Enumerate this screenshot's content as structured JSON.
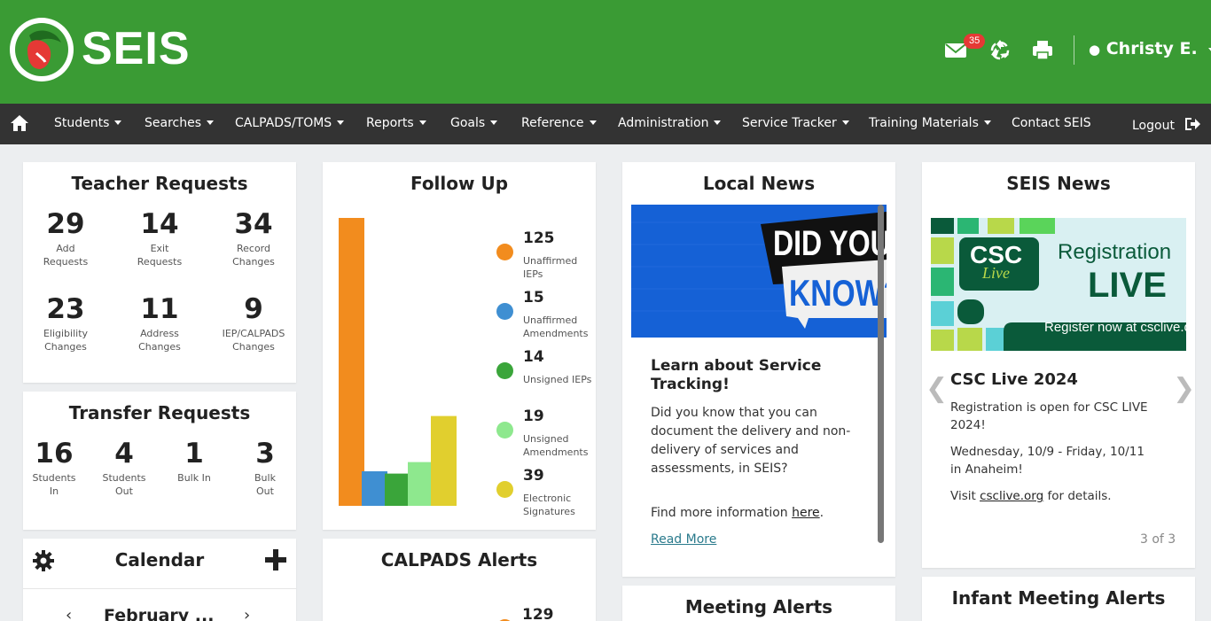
{
  "header": {
    "logo_text": "SEIS",
    "mail_badge": "35",
    "user_name": "Christy E."
  },
  "nav": {
    "items": [
      "Students",
      "Searches",
      "CALPADS/TOMS",
      "Reports",
      "Goals",
      "Reference",
      "Administration",
      "Service Tracker",
      "Training Materials",
      "Contact SEIS"
    ],
    "logout": "Logout"
  },
  "teacher_requests": {
    "title": "Teacher Requests",
    "stats": [
      {
        "num": "29",
        "l1": "Add",
        "l2": "Requests"
      },
      {
        "num": "14",
        "l1": "Exit",
        "l2": "Requests"
      },
      {
        "num": "34",
        "l1": "Record",
        "l2": "Changes"
      },
      {
        "num": "23",
        "l1": "Eligibility",
        "l2": "Changes"
      },
      {
        "num": "11",
        "l1": "Address",
        "l2": "Changes"
      },
      {
        "num": "9",
        "l1": "IEP/CALPADS",
        "l2": "Changes"
      }
    ]
  },
  "transfer_requests": {
    "title": "Transfer Requests",
    "stats": [
      {
        "num": "16",
        "l1": "Students",
        "l2": "In"
      },
      {
        "num": "4",
        "l1": "Students",
        "l2": "Out"
      },
      {
        "num": "1",
        "l1": "Bulk In",
        "l2": ""
      },
      {
        "num": "3",
        "l1": "Bulk",
        "l2": "Out"
      }
    ]
  },
  "calendar": {
    "title": "Calendar",
    "month": "February ..."
  },
  "follow_up": {
    "title": "Follow Up"
  },
  "chart_data": {
    "type": "bar",
    "categories": [
      "Unaffirmed IEPs",
      "Unaffirmed Amendments",
      "Unsigned IEPs",
      "Unsigned Amendments",
      "Electronic Signatures"
    ],
    "values": [
      125,
      15,
      14,
      19,
      39
    ],
    "colors": [
      "#f28c1e",
      "#3f8fd2",
      "#3aa53a",
      "#8ee88e",
      "#e1cf2e"
    ],
    "legend": [
      {
        "num": "125",
        "l1": "Unaffirmed",
        "l2": "IEPs"
      },
      {
        "num": "15",
        "l1": "Unaffirmed",
        "l2": "Amendments"
      },
      {
        "num": "14",
        "l1": "Unsigned IEPs",
        "l2": ""
      },
      {
        "num": "19",
        "l1": "Unsigned",
        "l2": "Amendments"
      },
      {
        "num": "39",
        "l1": "Electronic",
        "l2": "Signatures"
      }
    ]
  },
  "calpads_alerts": {
    "title": "CALPADS Alerts",
    "first_value": "129"
  },
  "local_news": {
    "title": "Local News",
    "image_text_1": "DID YOU",
    "image_text_2": "KNOW?",
    "heading": "Learn about Service Tracking!",
    "body": "Did you know that you can document the delivery and non-delivery of services and assessments, in SEIS?",
    "more_prefix": "Find more information ",
    "more_link": "here",
    "more_suffix": ".",
    "read_more": "Read More"
  },
  "meeting_alerts": {
    "title": "Meeting Alerts"
  },
  "seis_news": {
    "title": "SEIS News",
    "image_logo_1": "CSC",
    "image_logo_2": "Live",
    "image_text_1": "Registration",
    "image_text_2": "LIVE",
    "image_text_3": "Register now at csclive.org",
    "heading": "CSC Live 2024",
    "p1": "Registration is open for CSC LIVE 2024!",
    "p2": "Wednesday, 10/9 - Friday, 10/11 in Anaheim!",
    "p3_prefix": "Visit ",
    "p3_link": "csclive.org",
    "p3_suffix": " for details.",
    "pager": "3 of 3"
  },
  "infant_meeting_alerts": {
    "title": "Infant Meeting Alerts"
  }
}
